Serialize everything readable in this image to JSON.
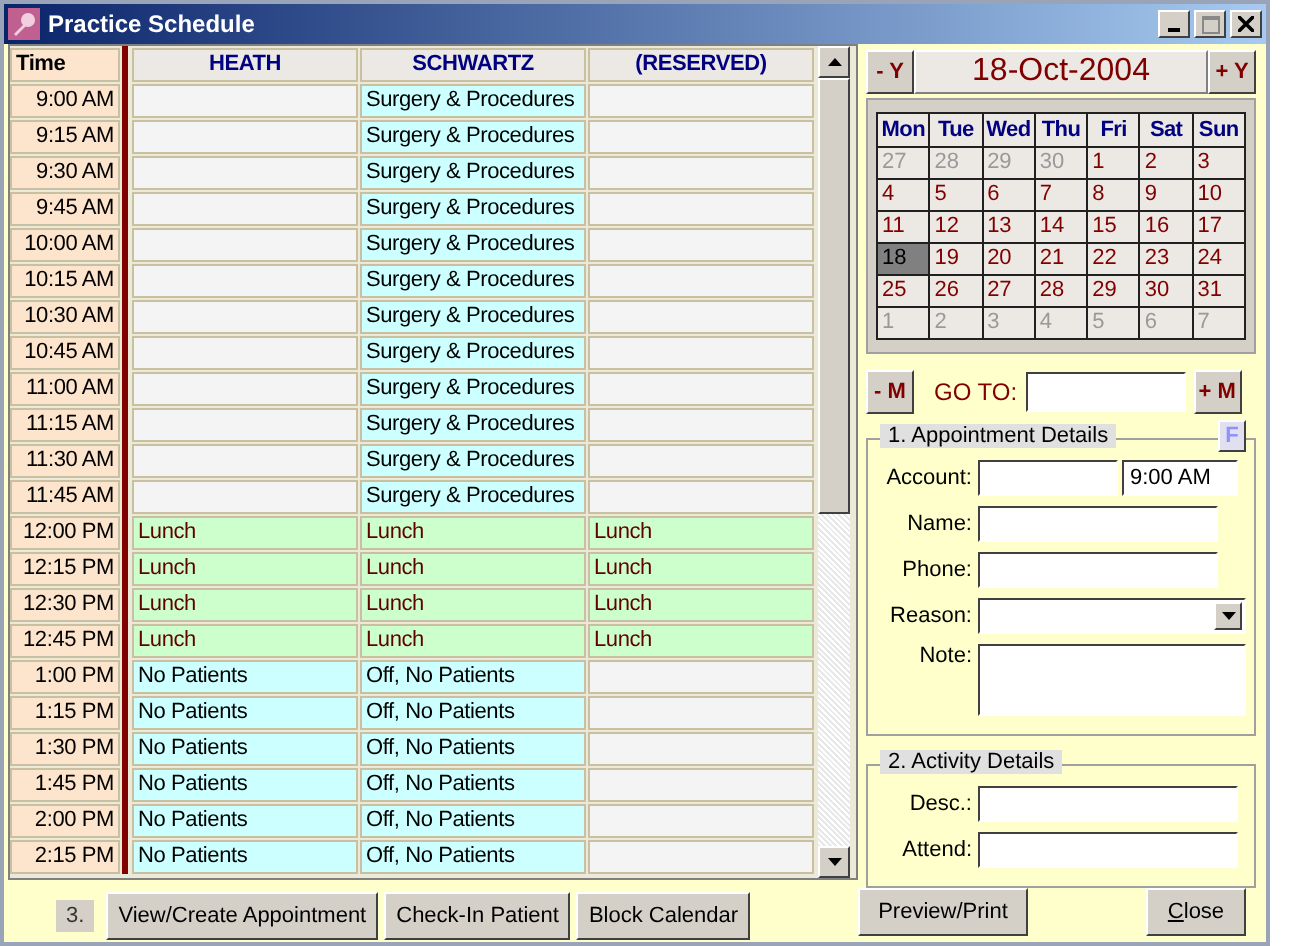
{
  "window": {
    "title": "Practice Schedule"
  },
  "schedule": {
    "columns": [
      "Time",
      "HEATH",
      "SCHWARTZ",
      "(RESERVED)"
    ],
    "rows": [
      {
        "cells": [
          {
            "kind": "time",
            "text": "9:00 AM"
          },
          {
            "kind": "empty"
          },
          {
            "kind": "block",
            "text": "Surgery & Procedures"
          },
          {
            "kind": "empty"
          }
        ]
      },
      {
        "cells": [
          {
            "kind": "time",
            "text": "9:15 AM"
          },
          {
            "kind": "empty"
          },
          {
            "kind": "block",
            "text": "Surgery & Procedures"
          },
          {
            "kind": "empty"
          }
        ]
      },
      {
        "cells": [
          {
            "kind": "time",
            "text": "9:30 AM"
          },
          {
            "kind": "empty"
          },
          {
            "kind": "block",
            "text": "Surgery & Procedures"
          },
          {
            "kind": "empty"
          }
        ]
      },
      {
        "cells": [
          {
            "kind": "time",
            "text": "9:45 AM"
          },
          {
            "kind": "empty"
          },
          {
            "kind": "block",
            "text": "Surgery & Procedures"
          },
          {
            "kind": "empty"
          }
        ]
      },
      {
        "cells": [
          {
            "kind": "time",
            "text": "10:00 AM"
          },
          {
            "kind": "empty"
          },
          {
            "kind": "block",
            "text": "Surgery & Procedures"
          },
          {
            "kind": "empty"
          }
        ]
      },
      {
        "cells": [
          {
            "kind": "time",
            "text": "10:15 AM"
          },
          {
            "kind": "empty"
          },
          {
            "kind": "block",
            "text": "Surgery & Procedures"
          },
          {
            "kind": "empty"
          }
        ]
      },
      {
        "cells": [
          {
            "kind": "time",
            "text": "10:30 AM"
          },
          {
            "kind": "empty"
          },
          {
            "kind": "block",
            "text": "Surgery & Procedures"
          },
          {
            "kind": "empty"
          }
        ]
      },
      {
        "cells": [
          {
            "kind": "time",
            "text": "10:45 AM"
          },
          {
            "kind": "empty"
          },
          {
            "kind": "block",
            "text": "Surgery & Procedures"
          },
          {
            "kind": "empty"
          }
        ]
      },
      {
        "cells": [
          {
            "kind": "time",
            "text": "11:00 AM"
          },
          {
            "kind": "empty"
          },
          {
            "kind": "block",
            "text": "Surgery & Procedures"
          },
          {
            "kind": "empty"
          }
        ]
      },
      {
        "cells": [
          {
            "kind": "time",
            "text": "11:15 AM"
          },
          {
            "kind": "empty"
          },
          {
            "kind": "block",
            "text": "Surgery & Procedures"
          },
          {
            "kind": "empty"
          }
        ]
      },
      {
        "cells": [
          {
            "kind": "time",
            "text": "11:30 AM"
          },
          {
            "kind": "empty"
          },
          {
            "kind": "block",
            "text": "Surgery & Procedures"
          },
          {
            "kind": "empty"
          }
        ]
      },
      {
        "cells": [
          {
            "kind": "time",
            "text": "11:45 AM"
          },
          {
            "kind": "empty"
          },
          {
            "kind": "block",
            "text": "Surgery & Procedures"
          },
          {
            "kind": "empty"
          }
        ]
      },
      {
        "cells": [
          {
            "kind": "time",
            "text": "12:00 PM"
          },
          {
            "kind": "lunch",
            "text": "Lunch"
          },
          {
            "kind": "lunch",
            "text": "Lunch"
          },
          {
            "kind": "lunch",
            "text": "Lunch"
          }
        ]
      },
      {
        "cells": [
          {
            "kind": "time",
            "text": "12:15 PM"
          },
          {
            "kind": "lunch",
            "text": "Lunch"
          },
          {
            "kind": "lunch",
            "text": "Lunch"
          },
          {
            "kind": "lunch",
            "text": "Lunch"
          }
        ]
      },
      {
        "cells": [
          {
            "kind": "time",
            "text": "12:30 PM"
          },
          {
            "kind": "lunch",
            "text": "Lunch"
          },
          {
            "kind": "lunch",
            "text": "Lunch"
          },
          {
            "kind": "lunch",
            "text": "Lunch"
          }
        ]
      },
      {
        "cells": [
          {
            "kind": "time",
            "text": "12:45 PM"
          },
          {
            "kind": "lunch",
            "text": "Lunch"
          },
          {
            "kind": "lunch",
            "text": "Lunch"
          },
          {
            "kind": "lunch",
            "text": "Lunch"
          }
        ]
      },
      {
        "cells": [
          {
            "kind": "time",
            "text": "1:00 PM"
          },
          {
            "kind": "block",
            "text": "No Patients"
          },
          {
            "kind": "block",
            "text": "Off, No Patients"
          },
          {
            "kind": "empty"
          }
        ]
      },
      {
        "cells": [
          {
            "kind": "time",
            "text": "1:15 PM"
          },
          {
            "kind": "block",
            "text": "No Patients"
          },
          {
            "kind": "block",
            "text": "Off, No Patients"
          },
          {
            "kind": "empty"
          }
        ]
      },
      {
        "cells": [
          {
            "kind": "time",
            "text": "1:30 PM"
          },
          {
            "kind": "block",
            "text": "No Patients"
          },
          {
            "kind": "block",
            "text": "Off, No Patients"
          },
          {
            "kind": "empty"
          }
        ]
      },
      {
        "cells": [
          {
            "kind": "time",
            "text": "1:45 PM"
          },
          {
            "kind": "block",
            "text": "No Patients"
          },
          {
            "kind": "block",
            "text": "Off, No Patients"
          },
          {
            "kind": "empty"
          }
        ]
      },
      {
        "cells": [
          {
            "kind": "time",
            "text": "2:00 PM"
          },
          {
            "kind": "block",
            "text": "No Patients"
          },
          {
            "kind": "block",
            "text": "Off, No Patients"
          },
          {
            "kind": "empty"
          }
        ]
      },
      {
        "cells": [
          {
            "kind": "time",
            "text": "2:15 PM"
          },
          {
            "kind": "block",
            "text": "No Patients"
          },
          {
            "kind": "block",
            "text": "Off, No Patients"
          },
          {
            "kind": "empty"
          }
        ]
      }
    ]
  },
  "calendar": {
    "prev_year": "- Y",
    "date": "18-Oct-2004",
    "next_year": "+ Y",
    "weekdays": [
      "Mon",
      "Tue",
      "Wed",
      "Thu",
      "Fri",
      "Sat",
      "Sun"
    ],
    "days": [
      {
        "day": "27",
        "muted": true,
        "selected": false
      },
      {
        "day": "28",
        "muted": true,
        "selected": false
      },
      {
        "day": "29",
        "muted": true,
        "selected": false
      },
      {
        "day": "30",
        "muted": true,
        "selected": false
      },
      {
        "day": "1",
        "muted": false,
        "selected": false
      },
      {
        "day": "2",
        "muted": false,
        "selected": false
      },
      {
        "day": "3",
        "muted": false,
        "selected": false
      },
      {
        "day": "4",
        "muted": false,
        "selected": false
      },
      {
        "day": "5",
        "muted": false,
        "selected": false
      },
      {
        "day": "6",
        "muted": false,
        "selected": false
      },
      {
        "day": "7",
        "muted": false,
        "selected": false
      },
      {
        "day": "8",
        "muted": false,
        "selected": false
      },
      {
        "day": "9",
        "muted": false,
        "selected": false
      },
      {
        "day": "10",
        "muted": false,
        "selected": false
      },
      {
        "day": "11",
        "muted": false,
        "selected": false
      },
      {
        "day": "12",
        "muted": false,
        "selected": false
      },
      {
        "day": "13",
        "muted": false,
        "selected": false
      },
      {
        "day": "14",
        "muted": false,
        "selected": false
      },
      {
        "day": "15",
        "muted": false,
        "selected": false
      },
      {
        "day": "16",
        "muted": false,
        "selected": false
      },
      {
        "day": "17",
        "muted": false,
        "selected": false
      },
      {
        "day": "18",
        "muted": false,
        "selected": true
      },
      {
        "day": "19",
        "muted": false,
        "selected": false
      },
      {
        "day": "20",
        "muted": false,
        "selected": false
      },
      {
        "day": "21",
        "muted": false,
        "selected": false
      },
      {
        "day": "22",
        "muted": false,
        "selected": false
      },
      {
        "day": "23",
        "muted": false,
        "selected": false
      },
      {
        "day": "24",
        "muted": false,
        "selected": false
      },
      {
        "day": "25",
        "muted": false,
        "selected": false
      },
      {
        "day": "26",
        "muted": false,
        "selected": false
      },
      {
        "day": "27",
        "muted": false,
        "selected": false
      },
      {
        "day": "28",
        "muted": false,
        "selected": false
      },
      {
        "day": "29",
        "muted": false,
        "selected": false
      },
      {
        "day": "30",
        "muted": false,
        "selected": false
      },
      {
        "day": "31",
        "muted": false,
        "selected": false
      },
      {
        "day": "1",
        "muted": true,
        "selected": false
      },
      {
        "day": "2",
        "muted": true,
        "selected": false
      },
      {
        "day": "3",
        "muted": true,
        "selected": false
      },
      {
        "day": "4",
        "muted": true,
        "selected": false
      },
      {
        "day": "5",
        "muted": true,
        "selected": false
      },
      {
        "day": "6",
        "muted": true,
        "selected": false
      },
      {
        "day": "7",
        "muted": true,
        "selected": false
      }
    ],
    "prev_month": "- M",
    "goto_label": "GO TO:",
    "next_month": "+ M"
  },
  "appointment": {
    "title": "1. Appointment Details",
    "f_button": "F",
    "account_label": "Account:",
    "time_value": "9:00 AM",
    "name_label": "Name:",
    "phone_label": "Phone:",
    "reason_label": "Reason:",
    "note_label": "Note:"
  },
  "activity": {
    "title": "2. Activity Details",
    "desc_label": "Desc.:",
    "attend_label": "Attend:"
  },
  "footer": {
    "step": "3.",
    "buttons": [
      "View/Create Appointment",
      "Check-In Patient",
      "Block Calendar"
    ],
    "preview": "Preview/Print",
    "close_prefix": "C",
    "close_rest": "lose"
  }
}
